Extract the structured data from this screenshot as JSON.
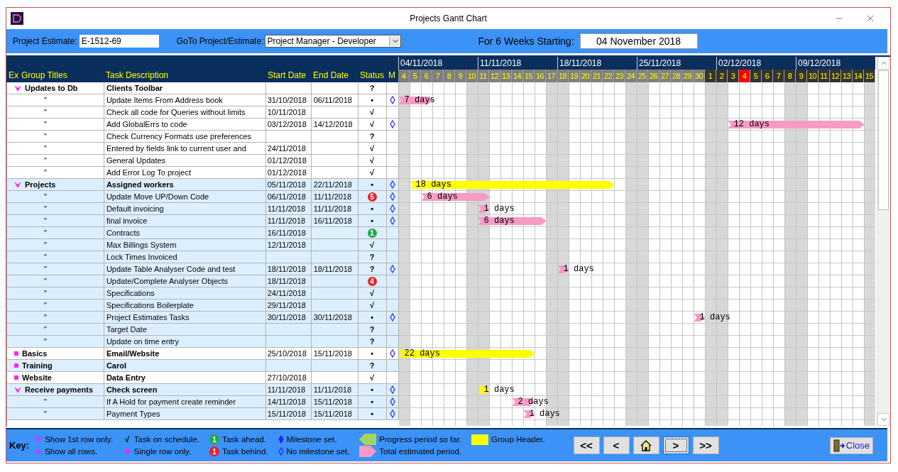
{
  "window": {
    "title": "Projects Gantt Chart"
  },
  "top_bar": {
    "estimate_label": "Project Estimate:",
    "estimate_value": "E-1512-69",
    "goto_label": "GoTo Project/Estimate:",
    "goto_value": "Project Manager - Developer",
    "weeks_label": "For 6 Weeks Starting:",
    "weeks_value": "04 November 2018"
  },
  "columns": [
    "Ex",
    "Group Titles",
    "Task Description",
    "Start Date",
    "End Date",
    "Status",
    "M"
  ],
  "weeks": [
    {
      "label": "04/11/2018"
    },
    {
      "label": "11/11/2018"
    },
    {
      "label": "18/11/2018"
    },
    {
      "label": "25/11/2018"
    },
    {
      "label": "02/12/2018"
    },
    {
      "label": "09/12/2018"
    }
  ],
  "days": [
    {
      "label": "4",
      "kind": "light",
      "weekend": true
    },
    {
      "label": "5",
      "kind": "light",
      "weekend": false
    },
    {
      "label": "6",
      "kind": "light",
      "weekend": false
    },
    {
      "label": "7",
      "kind": "light",
      "weekend": false
    },
    {
      "label": "8",
      "kind": "light",
      "weekend": false
    },
    {
      "label": "9",
      "kind": "light",
      "weekend": false
    },
    {
      "label": "10",
      "kind": "light",
      "weekend": true
    },
    {
      "label": "11",
      "kind": "light",
      "weekend": true
    },
    {
      "label": "12",
      "kind": "light",
      "weekend": false
    },
    {
      "label": "13",
      "kind": "light",
      "weekend": false
    },
    {
      "label": "14",
      "kind": "light",
      "weekend": false
    },
    {
      "label": "15",
      "kind": "light",
      "weekend": false
    },
    {
      "label": "16",
      "kind": "light",
      "weekend": false
    },
    {
      "label": "17",
      "kind": "light",
      "weekend": true
    },
    {
      "label": "18",
      "kind": "light",
      "weekend": true
    },
    {
      "label": "19",
      "kind": "light",
      "weekend": false
    },
    {
      "label": "20",
      "kind": "light",
      "weekend": false
    },
    {
      "label": "21",
      "kind": "light",
      "weekend": false
    },
    {
      "label": "22",
      "kind": "light",
      "weekend": false
    },
    {
      "label": "23",
      "kind": "light",
      "weekend": false
    },
    {
      "label": "24",
      "kind": "light",
      "weekend": true
    },
    {
      "label": "25",
      "kind": "light",
      "weekend": true
    },
    {
      "label": "26",
      "kind": "light",
      "weekend": false
    },
    {
      "label": "27",
      "kind": "light",
      "weekend": false
    },
    {
      "label": "28",
      "kind": "light",
      "weekend": false
    },
    {
      "label": "29",
      "kind": "light",
      "weekend": false
    },
    {
      "label": "30",
      "kind": "light",
      "weekend": false
    },
    {
      "label": "1",
      "kind": "dark",
      "weekend": true
    },
    {
      "label": "2",
      "kind": "dark",
      "weekend": true
    },
    {
      "label": "3",
      "kind": "dark",
      "weekend": false
    },
    {
      "label": "4",
      "kind": "today",
      "weekend": false
    },
    {
      "label": "5",
      "kind": "dark",
      "weekend": false
    },
    {
      "label": "6",
      "kind": "dark",
      "weekend": false
    },
    {
      "label": "7",
      "kind": "dark",
      "weekend": false
    },
    {
      "label": "8",
      "kind": "dark",
      "weekend": true
    },
    {
      "label": "9",
      "kind": "dark",
      "weekend": true
    },
    {
      "label": "10",
      "kind": "dark",
      "weekend": false
    },
    {
      "label": "11",
      "kind": "dark",
      "weekend": false
    },
    {
      "label": "12",
      "kind": "dark",
      "weekend": false
    },
    {
      "label": "13",
      "kind": "dark",
      "weekend": false
    },
    {
      "label": "14",
      "kind": "dark",
      "weekend": false
    },
    {
      "label": "15",
      "kind": "dark",
      "weekend": true
    }
  ],
  "rows": [
    {
      "kind": "expandable",
      "shaded": false,
      "group": "Updates to Db",
      "task": "Clients Toolbar",
      "status": {
        "kind": "symbol",
        "text": "?"
      },
      "milestone": false
    },
    {
      "kind": "task",
      "shaded": false,
      "group": "\"",
      "task": "Update Items From Address book",
      "start": "31/10/2018",
      "end": "06/11/2018",
      "status": {
        "kind": "symbol",
        "text": "•"
      },
      "milestone": true,
      "bar_label": "7 days"
    },
    {
      "kind": "task",
      "shaded": false,
      "group": "\"",
      "task": "Check all code for Queries without limits",
      "start": "10/11/2018",
      "status": {
        "kind": "symbol",
        "text": "√"
      },
      "milestone": false
    },
    {
      "kind": "task",
      "shaded": false,
      "group": "\"",
      "task": "Add GlobalErrs to code",
      "start": "03/12/2018",
      "end": "14/12/2018",
      "status": {
        "kind": "symbol",
        "text": "√"
      },
      "milestone": true,
      "bar_label": "12 days"
    },
    {
      "kind": "task",
      "shaded": false,
      "group": "\"",
      "task": "Check Currency Formats use preferences",
      "status": {
        "kind": "symbol",
        "text": "?"
      },
      "milestone": false
    },
    {
      "kind": "task",
      "shaded": false,
      "group": "\"",
      "task": "Entered by fields link to current user and",
      "start": "24/11/2018",
      "status": {
        "kind": "symbol",
        "text": "√"
      },
      "milestone": false
    },
    {
      "kind": "task",
      "shaded": false,
      "group": "\"",
      "task": "General Updates",
      "start": "01/12/2018",
      "status": {
        "kind": "symbol",
        "text": "√"
      },
      "milestone": false
    },
    {
      "kind": "task",
      "shaded": false,
      "group": "\"",
      "task": "Add Error Log To project",
      "start": "01/12/2018",
      "status": {
        "kind": "symbol",
        "text": "√"
      },
      "milestone": false
    },
    {
      "kind": "expandable",
      "shaded": true,
      "group": "Projects",
      "task": "Assigned workers",
      "start": "05/11/2018",
      "end": "22/11/2018",
      "status": {
        "kind": "symbol",
        "text": "•"
      },
      "milestone": true,
      "bar_label": "18 days"
    },
    {
      "kind": "task",
      "shaded": true,
      "group": "\"",
      "task": "Update Move UP/Down Code",
      "start": "06/11/2018",
      "end": "11/11/2018",
      "status": {
        "kind": "behind",
        "text": "5"
      },
      "milestone": true,
      "bar_label": "6 days"
    },
    {
      "kind": "task",
      "shaded": true,
      "group": "\"",
      "task": "Default invoicing",
      "start": "11/11/2018",
      "end": "11/11/2018",
      "status": {
        "kind": "symbol",
        "text": "•"
      },
      "milestone": true,
      "bar_label": "1 days"
    },
    {
      "kind": "task",
      "shaded": true,
      "group": "\"",
      "task": "final invoice",
      "start": "11/11/2018",
      "end": "16/11/2018",
      "status": {
        "kind": "symbol",
        "text": "•"
      },
      "milestone": true,
      "bar_label": "6 days"
    },
    {
      "kind": "task",
      "shaded": true,
      "group": "\"",
      "task": "Contracts",
      "start": "16/11/2018",
      "status": {
        "kind": "ahead",
        "text": "1"
      },
      "milestone": false
    },
    {
      "kind": "task",
      "shaded": true,
      "group": "\"",
      "task": "Max Billings System",
      "start": "12/11/2018",
      "status": {
        "kind": "symbol",
        "text": "√"
      },
      "milestone": false
    },
    {
      "kind": "task",
      "shaded": true,
      "group": "\"",
      "task": "Lock Times Invoiced",
      "status": {
        "kind": "symbol",
        "text": "?"
      },
      "milestone": false
    },
    {
      "kind": "task",
      "shaded": true,
      "group": "\"",
      "task": "Update Table Analyser Code and test",
      "start": "18/11/2018",
      "end": "18/11/2018",
      "status": {
        "kind": "symbol",
        "text": "?"
      },
      "milestone": true,
      "bar_label": "1 days"
    },
    {
      "kind": "task",
      "shaded": true,
      "group": "\"",
      "task": "Update/Complete Analyser Objects",
      "start": "18/11/2018",
      "status": {
        "kind": "behind",
        "text": "4"
      },
      "milestone": false
    },
    {
      "kind": "task",
      "shaded": true,
      "group": "\"",
      "task": "Specifications",
      "start": "24/11/2018",
      "status": {
        "kind": "symbol",
        "text": "√"
      },
      "milestone": false
    },
    {
      "kind": "task",
      "shaded": true,
      "group": "\"",
      "task": "Specifications Boilerplate",
      "start": "29/11/2018",
      "status": {
        "kind": "symbol",
        "text": "√"
      },
      "milestone": false
    },
    {
      "kind": "task",
      "shaded": true,
      "group": "\"",
      "task": "Project Estimates Tasks",
      "start": "30/11/2018",
      "end": "30/11/2018",
      "status": {
        "kind": "symbol",
        "text": "•"
      },
      "milestone": true,
      "bar_label": "1 days"
    },
    {
      "kind": "task",
      "shaded": true,
      "group": "\"",
      "task": "Target Date",
      "status": {
        "kind": "symbol",
        "text": "?"
      },
      "milestone": false
    },
    {
      "kind": "task",
      "shaded": true,
      "group": "\"",
      "task": "Update on time entry",
      "status": {
        "kind": "symbol",
        "text": "?"
      },
      "milestone": false
    },
    {
      "kind": "single",
      "shaded": false,
      "group": "Basics",
      "task": "Email/Website",
      "start": "25/10/2018",
      "end": "15/11/2018",
      "status": {
        "kind": "symbol",
        "text": "•"
      },
      "milestone": true,
      "bar_label": "22 days"
    },
    {
      "kind": "single",
      "shaded": true,
      "group": "Training",
      "task": "Carol",
      "status": {
        "kind": "symbol",
        "text": "?"
      },
      "milestone": false
    },
    {
      "kind": "single",
      "shaded": false,
      "group": "Website",
      "task": "Data Entry",
      "start": "27/10/2018",
      "status": {
        "kind": "symbol",
        "text": "√"
      },
      "milestone": false
    },
    {
      "kind": "expandable",
      "shaded": true,
      "group": "Receive payments",
      "task": "Check screen",
      "start": "11/11/2018",
      "end": "11/11/2018",
      "status": {
        "kind": "symbol",
        "text": "•"
      },
      "milestone": true,
      "bar_label": "1 days"
    },
    {
      "kind": "task",
      "shaded": true,
      "group": "\"",
      "task": "If A Hold for payment create reminder",
      "start": "14/11/2018",
      "end": "15/11/2018",
      "status": {
        "kind": "symbol",
        "text": "•"
      },
      "milestone": true,
      "bar_label": "2 days"
    },
    {
      "kind": "task",
      "shaded": true,
      "group": "\"",
      "task": "Payment Types",
      "start": "15/11/2018",
      "end": "15/11/2018",
      "status": {
        "kind": "symbol",
        "text": "•"
      },
      "milestone": true,
      "bar_label": "1 days"
    }
  ],
  "key": {
    "label": "Key:",
    "items": [
      {
        "kind": "chevron-right",
        "text": "Show 1st row only."
      },
      {
        "kind": "chevron-down",
        "text": "Show all rows."
      },
      {
        "kind": "symbol",
        "symbol": "√",
        "text": "Task on schedule."
      },
      {
        "kind": "square",
        "text": "Single row only."
      },
      {
        "kind": "ahead",
        "badge": "1",
        "text": "Task ahead."
      },
      {
        "kind": "behind",
        "badge": "1",
        "text": "Task behind."
      },
      {
        "kind": "diamond-filled",
        "text": "Milestone set."
      },
      {
        "kind": "diamond-open",
        "text": "No milestone set."
      },
      {
        "kind": "progress-shape",
        "text": "Progress period so far."
      },
      {
        "kind": "total-shape",
        "text": "Total estimated period."
      },
      {
        "kind": "swatch",
        "text": "Group Header."
      }
    ]
  },
  "nav_buttons": [
    {
      "kind": "text",
      "text": "<<",
      "focused": false
    },
    {
      "kind": "text",
      "text": "<",
      "focused": false
    },
    {
      "kind": "home",
      "focused": false
    },
    {
      "kind": "text",
      "text": ">",
      "focused": true
    },
    {
      "kind": "text",
      "text": ">>",
      "focused": false
    }
  ],
  "close_button": {
    "text": "Close"
  }
}
